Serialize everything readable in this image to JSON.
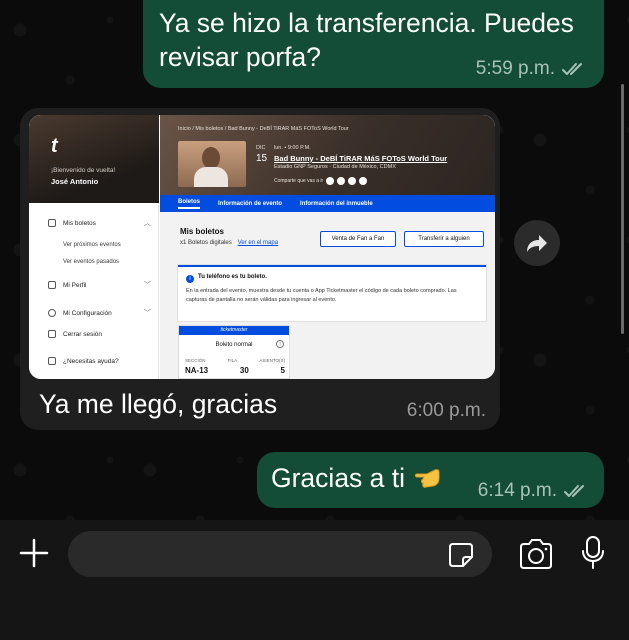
{
  "messages": [
    {
      "direction": "outgoing",
      "text": "Ya se hizo la transferencia. Puedes revisar porfa?",
      "time": "5:59 p.m.",
      "status": "read"
    },
    {
      "direction": "incoming",
      "text": "Ya me llegó, gracias",
      "time": "6:00 p.m.",
      "has_image": true
    },
    {
      "direction": "outgoing",
      "text": "Gracias a ti",
      "emoji": "backhand-index-pointing-left",
      "time": "6:14 p.m.",
      "status": "read"
    }
  ],
  "screenshot": {
    "logo": "t",
    "welcome": "¡Bienvenido de vuelta!",
    "user_name": "José Antonio",
    "nav": {
      "my_tickets": "Mis boletos",
      "upcoming": "Ver próximos eventos",
      "past": "Ver eventos pasados",
      "profile": "Mi Perfil",
      "settings": "Mi Configuración",
      "logout": "Cerrar sesión",
      "help": "¿Necesitas ayuda?"
    },
    "breadcrumb": "Inicio / Mis boletos / Bad Bunny - DeBÍ TiRAR MáS FOToS World Tour",
    "event": {
      "month": "DIC",
      "day": "15",
      "time": "lun. • 9:00 P.M.",
      "title": "Bad Bunny - DeBÍ TiRAR MáS FOToS World Tour",
      "venue": "Estadio GNP Seguros · Ciudad de México, CDMX",
      "share": "Comparte que vas a ir"
    },
    "tabs": [
      "Boletos",
      "Información de evento",
      "Información del inmueble"
    ],
    "tickets_card": {
      "title": "Mis boletos",
      "count": "x1 Boletos digitales",
      "map_link": "Ver en el mapa",
      "sell_button": "Venta de Fan a Fan",
      "transfer_button": "Transferir a alguien"
    },
    "alert": {
      "title": "Tu teléfono es tu boleto.",
      "body": "En la entrada del evento, muestra desde tu cuenta o App Ticketmaster el código de cada boleto comprado. Las capturas de pantalla no serán válidas para ingresar al evento."
    },
    "ticket": {
      "brand": "ticketmaster",
      "type": "Boleto normal",
      "headers": [
        "SECCIÓN",
        "FILA",
        "ASIENTO(S)"
      ],
      "values": [
        "NA-13",
        "30",
        "5"
      ]
    }
  },
  "composer": {
    "placeholder": "",
    "icons": [
      "plus-icon",
      "sticker-icon",
      "camera-icon",
      "microphone-icon"
    ]
  },
  "colors": {
    "outgoing_bubble": "#144d37",
    "incoming_bubble": "#1f1f1f",
    "read_ticks": "#a7c2b6",
    "ticketmaster_blue": "#024ddf"
  }
}
